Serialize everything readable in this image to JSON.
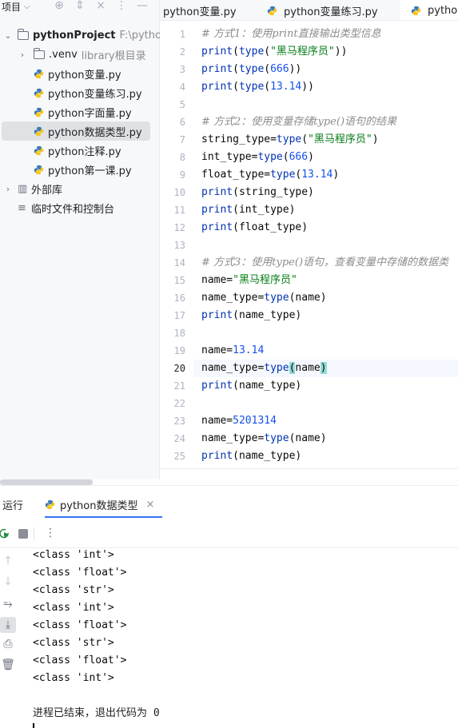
{
  "project_panel": {
    "title": "项目",
    "tree": [
      {
        "kind": "root",
        "label": "pythonProject",
        "path": "F:\\pythonP",
        "arrow": "⌄"
      },
      {
        "kind": "folder",
        "label": ".venv",
        "note": "library根目录",
        "arrow": "›"
      },
      {
        "kind": "file",
        "label": "python变量.py"
      },
      {
        "kind": "file",
        "label": "python变量练习.py"
      },
      {
        "kind": "file",
        "label": "python字面量.py"
      },
      {
        "kind": "file",
        "label": "python数据类型.py",
        "selected": true
      },
      {
        "kind": "file",
        "label": "python注释.py"
      },
      {
        "kind": "file",
        "label": "python第一课.py"
      },
      {
        "kind": "lib",
        "label": "外部库",
        "arrow": "›"
      },
      {
        "kind": "scratch",
        "label": "临时文件和控制台"
      }
    ]
  },
  "tabs": [
    "python变量.py",
    "python变量练习.py",
    "pythor"
  ],
  "editor": {
    "current_line": 20,
    "lines": [
      "# 方式1：使用print直接输出类型信息",
      "print(type(\"黑马程序员\"))",
      "print(type(666))",
      "print(type(13.14))",
      "",
      "# 方式2：使用变量存储type()语句的结果",
      "string_type=type(\"黑马程序员\")",
      "int_type=type(666)",
      "float_type=type(13.14)",
      "print(string_type)",
      "print(int_type)",
      "print(float_type)",
      "",
      "# 方式3：使用type()语句，查看变量中存储的数据类",
      "name=\"黑马程序员\"",
      "name_type=type(name)",
      "print(name_type)",
      "",
      "name=13.14",
      "name_type=type(name)",
      "print(name_type)",
      "",
      "name=5201314",
      "name_type=type(name)",
      "print(name_type)"
    ]
  },
  "run_panel": {
    "title": "运行",
    "tab_label": "python数据类型",
    "output": [
      "<class 'int'>",
      "<class 'float'>",
      "<class 'str'>",
      "<class 'int'>",
      "<class 'float'>",
      "<class 'str'>",
      "<class 'float'>",
      "<class 'int'>",
      "",
      "进程已结束，退出代码为 0"
    ]
  },
  "colors": {
    "keyword": "#0033b3",
    "string": "#067d17",
    "number": "#1750eb",
    "comment": "#8c8c8c",
    "accent": "#3574f0"
  }
}
